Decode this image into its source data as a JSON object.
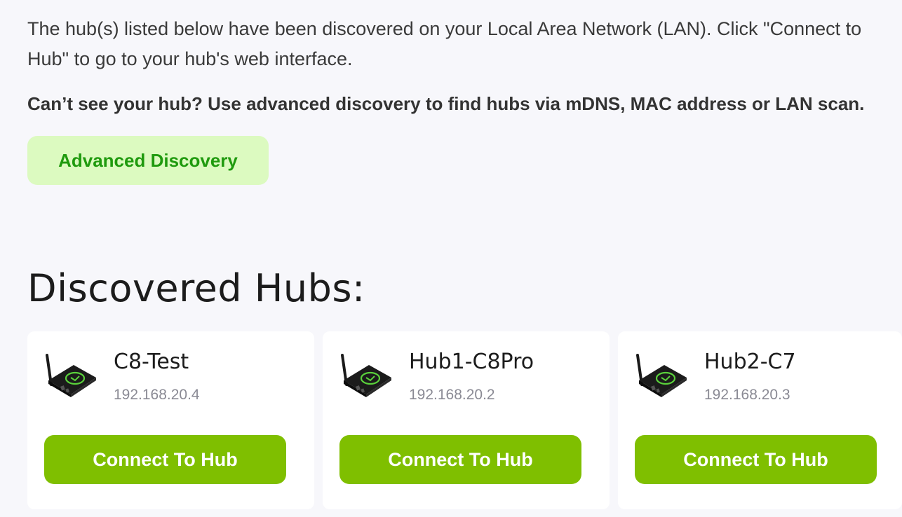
{
  "intro": {
    "text": "The hub(s) listed below have been discovered on your Local Area Network (LAN). Click \"Connect to Hub\" to go to your hub's web interface.",
    "hint": "Can’t see your hub? Use advanced discovery to find hubs via mDNS, MAC address or LAN scan.",
    "advanced_button_label": "Advanced Discovery"
  },
  "section": {
    "title": "Discovered Hubs:"
  },
  "hubs": [
    {
      "name": "C8-Test",
      "ip": "192.168.20.4",
      "button_label": "Connect To Hub",
      "icon": "hub-device-icon"
    },
    {
      "name": "Hub1-C8Pro",
      "ip": "192.168.20.2",
      "button_label": "Connect To Hub",
      "icon": "hub-device-icon"
    },
    {
      "name": "Hub2-C7",
      "ip": "192.168.20.3",
      "button_label": "Connect To Hub",
      "icon": "hub-device-icon"
    }
  ],
  "colors": {
    "background": "#f7f7fb",
    "accent": "#7fbf00",
    "advanced_bg": "#dcfac0",
    "advanced_text": "#1f9a0e",
    "ip_text": "#8a8a94"
  }
}
